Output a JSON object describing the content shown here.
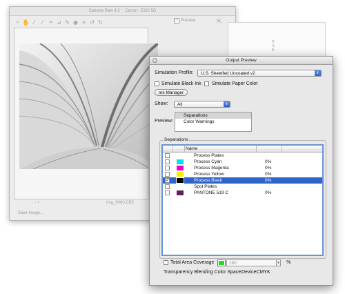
{
  "camera_raw": {
    "title": "Camera Raw 4.2",
    "camera": "Canon - EOS 5D",
    "preview_label": "Preview",
    "tools": [
      "zoom-icon",
      "hand-icon",
      "eyedropper-icon",
      "color-sampler-icon",
      "crop-icon",
      "straighten-icon",
      "retouch-icon",
      "redeye-icon",
      "preferences-icon",
      "rotate-left-icon",
      "rotate-right-icon"
    ],
    "readout": "R: G: B:",
    "status_zoom": "-",
    "status_plus": "+",
    "filename": "Img_0000.CR2",
    "save_label": "Save Image..."
  },
  "output_preview": {
    "title": "Output Preview",
    "simulation_profile_label": "Simulation Profile:",
    "simulation_profile_value": "U.S. Sheetfed Uncoated v2",
    "simulate_black_ink": "Simulate Black Ink",
    "simulate_paper_color": "Simulate Paper Color",
    "ink_manager": "Ink Manager",
    "show_label": "Show:",
    "show_value": "All",
    "preview_label": "Preview:",
    "preview_options": [
      "Separations",
      "Color Warnings"
    ],
    "separations_group": "Separations",
    "table_header_name": "Name",
    "separations": [
      {
        "checked": false,
        "swatch": "",
        "name": "Process Plates",
        "pct": "",
        "selected": false
      },
      {
        "checked": false,
        "swatch": "#00e0ee",
        "name": "Process Cyan",
        "pct": "0%",
        "selected": false
      },
      {
        "checked": false,
        "swatch": "#ee00c8",
        "name": "Process Magenta",
        "pct": "0%",
        "selected": false
      },
      {
        "checked": false,
        "swatch": "#f2ee00",
        "name": "Process Yellow",
        "pct": "0%",
        "selected": false
      },
      {
        "checked": true,
        "swatch": "#000000",
        "name": "Process Black",
        "pct": "0%",
        "selected": true
      },
      {
        "checked": false,
        "swatch": "",
        "name": "Spot Plates",
        "pct": "",
        "selected": false
      },
      {
        "checked": false,
        "swatch": "#5e1e5e",
        "name": "PANTONE 519 C",
        "pct": "0%",
        "selected": false
      }
    ],
    "total_area_coverage_label": "Total Area Coverage",
    "total_area_coverage_color": "#22dd22",
    "total_area_coverage_value": "280",
    "total_area_coverage_unit": "%",
    "transparency_label": "Transparency Blending Color Space:",
    "transparency_value": "DeviceCMYK"
  }
}
